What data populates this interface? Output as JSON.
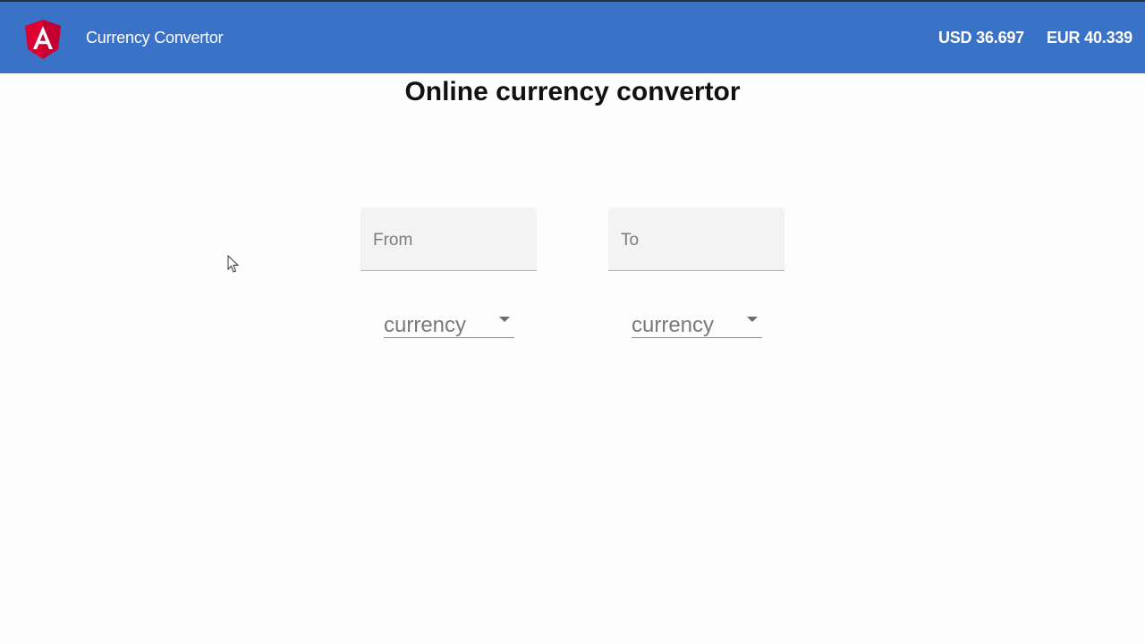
{
  "header": {
    "title": "Currency Convertor",
    "logo_icon": "angular-logo-icon",
    "brand_color": "#3a72c8",
    "logo_color": "#dd0031",
    "rates": [
      {
        "label": "USD 36.697"
      },
      {
        "label": "EUR 40.339"
      }
    ]
  },
  "main": {
    "heading": "Online currency convertor",
    "from_field": {
      "placeholder": "From",
      "value": ""
    },
    "to_field": {
      "placeholder": "To",
      "value": ""
    },
    "from_select": {
      "selected": "currency"
    },
    "to_select": {
      "selected": "currency"
    }
  }
}
